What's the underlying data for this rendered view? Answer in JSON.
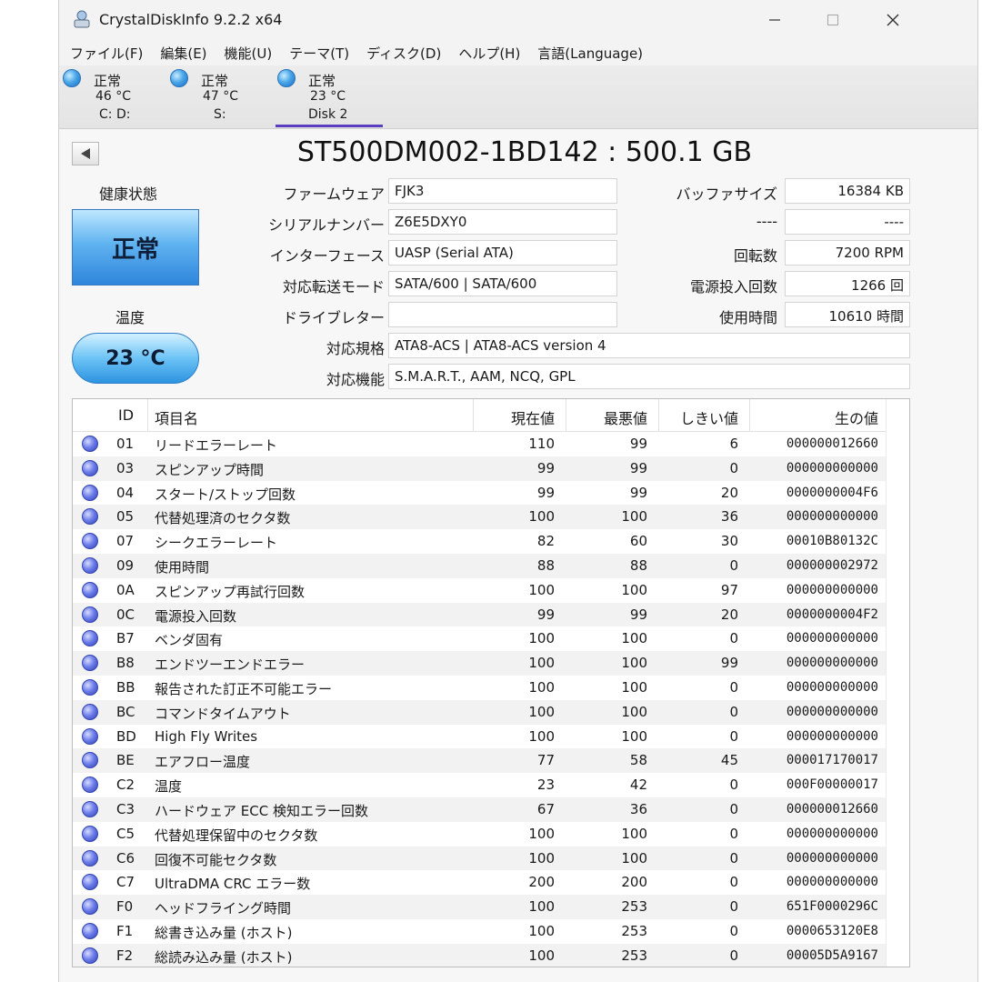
{
  "window": {
    "title": "CrystalDiskInfo 9.2.2 x64"
  },
  "menu": [
    "ファイル(F)",
    "編集(E)",
    "機能(U)",
    "テーマ(T)",
    "ディスク(D)",
    "ヘルプ(H)",
    "言語(Language)"
  ],
  "disk_tabs": [
    {
      "status": "正常",
      "temp": "46 °C",
      "drive": "C: D:"
    },
    {
      "status": "正常",
      "temp": "47 °C",
      "drive": "S:"
    },
    {
      "status": "正常",
      "temp": "23 °C",
      "drive": "Disk 2"
    }
  ],
  "disk": {
    "title": "ST500DM002-1BD142 : 500.1 GB",
    "health_label": "健康状態",
    "health_value": "正常",
    "temp_label": "温度",
    "temp_value": "23 °C"
  },
  "fields": {
    "firmware_label": "ファームウェア",
    "firmware": "FJK3",
    "serial_label": "シリアルナンバー",
    "serial": "Z6E5DXY0",
    "interface_label": "インターフェース",
    "interface": "UASP (Serial ATA)",
    "transfer_label": "対応転送モード",
    "transfer": "SATA/600 | SATA/600",
    "driveletter_label": "ドライブレター",
    "driveletter": "",
    "standard_label": "対応規格",
    "standard": "ATA8-ACS | ATA8-ACS version 4",
    "features_label": "対応機能",
    "features": "S.M.A.R.T., AAM, NCQ, GPL",
    "buffer_label": "バッファサイズ",
    "buffer": "16384 KB",
    "blank_label": "----",
    "blank": "----",
    "rotation_label": "回転数",
    "rotation": "7200 RPM",
    "powercount_label": "電源投入回数",
    "powercount": "1266 回",
    "hours_label": "使用時間",
    "hours": "10610 時間"
  },
  "smart_headers": {
    "id": "ID",
    "name": "項目名",
    "current": "現在値",
    "worst": "最悪値",
    "threshold": "しきい値",
    "raw": "生の値"
  },
  "smart_rows": [
    {
      "id": "01",
      "name": "リードエラーレート",
      "current": "110",
      "worst": "99",
      "threshold": "6",
      "raw": "000000012660"
    },
    {
      "id": "03",
      "name": "スピンアップ時間",
      "current": "99",
      "worst": "99",
      "threshold": "0",
      "raw": "000000000000"
    },
    {
      "id": "04",
      "name": "スタート/ストップ回数",
      "current": "99",
      "worst": "99",
      "threshold": "20",
      "raw": "0000000004F6"
    },
    {
      "id": "05",
      "name": "代替処理済のセクタ数",
      "current": "100",
      "worst": "100",
      "threshold": "36",
      "raw": "000000000000"
    },
    {
      "id": "07",
      "name": "シークエラーレート",
      "current": "82",
      "worst": "60",
      "threshold": "30",
      "raw": "00010B80132C"
    },
    {
      "id": "09",
      "name": "使用時間",
      "current": "88",
      "worst": "88",
      "threshold": "0",
      "raw": "000000002972"
    },
    {
      "id": "0A",
      "name": "スピンアップ再試行回数",
      "current": "100",
      "worst": "100",
      "threshold": "97",
      "raw": "000000000000"
    },
    {
      "id": "0C",
      "name": "電源投入回数",
      "current": "99",
      "worst": "99",
      "threshold": "20",
      "raw": "0000000004F2"
    },
    {
      "id": "B7",
      "name": "ベンダ固有",
      "current": "100",
      "worst": "100",
      "threshold": "0",
      "raw": "000000000000"
    },
    {
      "id": "B8",
      "name": "エンドツーエンドエラー",
      "current": "100",
      "worst": "100",
      "threshold": "99",
      "raw": "000000000000"
    },
    {
      "id": "BB",
      "name": "報告された訂正不可能エラー",
      "current": "100",
      "worst": "100",
      "threshold": "0",
      "raw": "000000000000"
    },
    {
      "id": "BC",
      "name": "コマンドタイムアウト",
      "current": "100",
      "worst": "100",
      "threshold": "0",
      "raw": "000000000000"
    },
    {
      "id": "BD",
      "name": "High Fly Writes",
      "current": "100",
      "worst": "100",
      "threshold": "0",
      "raw": "000000000000"
    },
    {
      "id": "BE",
      "name": "エアフロー温度",
      "current": "77",
      "worst": "58",
      "threshold": "45",
      "raw": "000017170017"
    },
    {
      "id": "C2",
      "name": "温度",
      "current": "23",
      "worst": "42",
      "threshold": "0",
      "raw": "000F00000017"
    },
    {
      "id": "C3",
      "name": "ハードウェア ECC 検知エラー回数",
      "current": "67",
      "worst": "36",
      "threshold": "0",
      "raw": "000000012660"
    },
    {
      "id": "C5",
      "name": "代替処理保留中のセクタ数",
      "current": "100",
      "worst": "100",
      "threshold": "0",
      "raw": "000000000000"
    },
    {
      "id": "C6",
      "name": "回復不可能セクタ数",
      "current": "100",
      "worst": "100",
      "threshold": "0",
      "raw": "000000000000"
    },
    {
      "id": "C7",
      "name": "UltraDMA CRC エラー数",
      "current": "200",
      "worst": "200",
      "threshold": "0",
      "raw": "000000000000"
    },
    {
      "id": "F0",
      "name": "ヘッドフライング時間",
      "current": "100",
      "worst": "253",
      "threshold": "0",
      "raw": "651F0000296C"
    },
    {
      "id": "F1",
      "name": "総書き込み量 (ホスト)",
      "current": "100",
      "worst": "253",
      "threshold": "0",
      "raw": "0000653120E8"
    },
    {
      "id": "F2",
      "name": "総読み込み量 (ホスト)",
      "current": "100",
      "worst": "253",
      "threshold": "0",
      "raw": "00005D5A9167"
    }
  ]
}
